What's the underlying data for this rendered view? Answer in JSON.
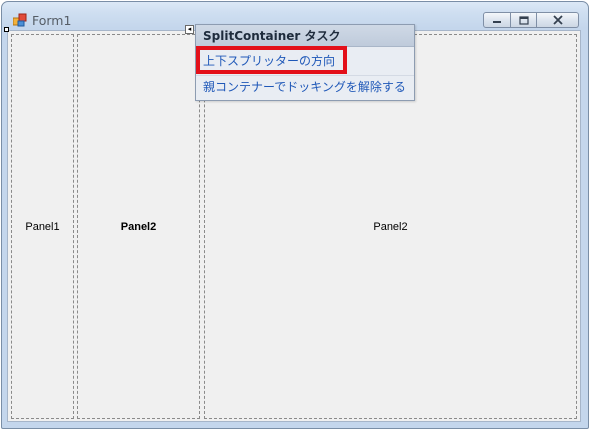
{
  "window": {
    "title": "Form1",
    "minimize_label": "minimize",
    "maximize_label": "maximize",
    "close_label": "close"
  },
  "panels": [
    {
      "label": "Panel1",
      "bold": false
    },
    {
      "label": "Panel2",
      "bold": true
    },
    {
      "label": "Panel2",
      "bold": false
    }
  ],
  "smart_tag": {
    "title": "SplitContainer タスク",
    "items": [
      {
        "label": "上下スプリッターの方向",
        "highlighted": true
      },
      {
        "label": "親コンテナーでドッキングを解除する",
        "highlighted": false
      }
    ]
  },
  "icons": {
    "app": "form-icon",
    "minimize": "minimize-icon",
    "maximize": "maximize-icon",
    "close": "close-icon",
    "collapse": "collapse-arrow-icon"
  },
  "colors": {
    "highlight": "#e3101a",
    "link": "#1f58b8"
  }
}
